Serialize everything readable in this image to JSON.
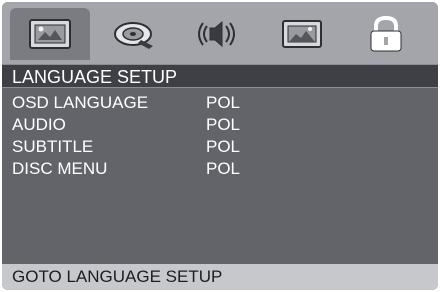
{
  "tabs": [
    {
      "icon": "general-setup-icon"
    },
    {
      "icon": "video-disc-icon"
    },
    {
      "icon": "audio-speaker-icon"
    },
    {
      "icon": "picture-setup-icon"
    },
    {
      "icon": "lock-icon"
    }
  ],
  "header": {
    "title": "LANGUAGE SETUP"
  },
  "rows": [
    {
      "label": "OSD LANGUAGE",
      "value": "POL"
    },
    {
      "label": "AUDIO",
      "value": "POL"
    },
    {
      "label": "SUBTITLE",
      "value": "POL"
    },
    {
      "label": "DISC MENU",
      "value": "POL"
    }
  ],
  "footer": {
    "hint": "GOTO LANGUAGE SETUP"
  },
  "colors": {
    "background": "#63646a",
    "iconbar": "#a4a5aa",
    "header": "#3f4045",
    "footer": "#c7c8cc"
  }
}
